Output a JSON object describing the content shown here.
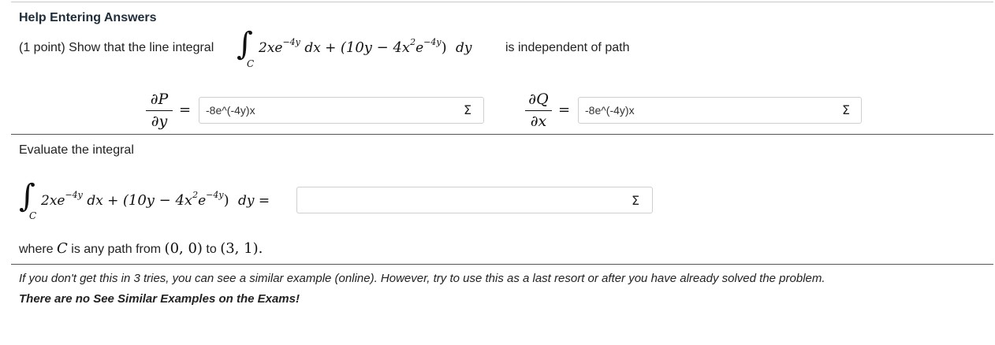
{
  "header": {
    "title": "Help Entering Answers"
  },
  "problem": {
    "intro": "(1 point) Show that the line integral",
    "integrand_a": "2xe",
    "exp": "−4y",
    "dx": "dx +",
    "paren_open": "(10y − 4x",
    "sq": "2",
    "e": "e",
    "exp2": "−4y",
    "paren_close": ")",
    "dy": "dy",
    "suffix": "is independent of path",
    "sub_c": "C"
  },
  "partials": {
    "p_num": "∂P",
    "p_den": "∂y",
    "q_num": "∂Q",
    "q_den": "∂x",
    "equals": "=",
    "p_answer": "-8e^(-4y)x",
    "q_answer": "-8e^(-4y)x",
    "sigma": "Σ"
  },
  "evaluate": {
    "label": "Evaluate the integral",
    "dy_eq": "dy =",
    "answer": "",
    "where_prefix": "where",
    "C": "C",
    "where_mid": "is any path from",
    "p0": "(0, 0)",
    "to": "to",
    "p1": "(3, 1)",
    "period": "."
  },
  "footer": {
    "note": "If you don't get this in 3 tries, you can see a similar example (online). However, try to use this as a last resort or after you have already solved the problem.",
    "note_bold": "There are no See Similar Examples on the Exams!"
  }
}
